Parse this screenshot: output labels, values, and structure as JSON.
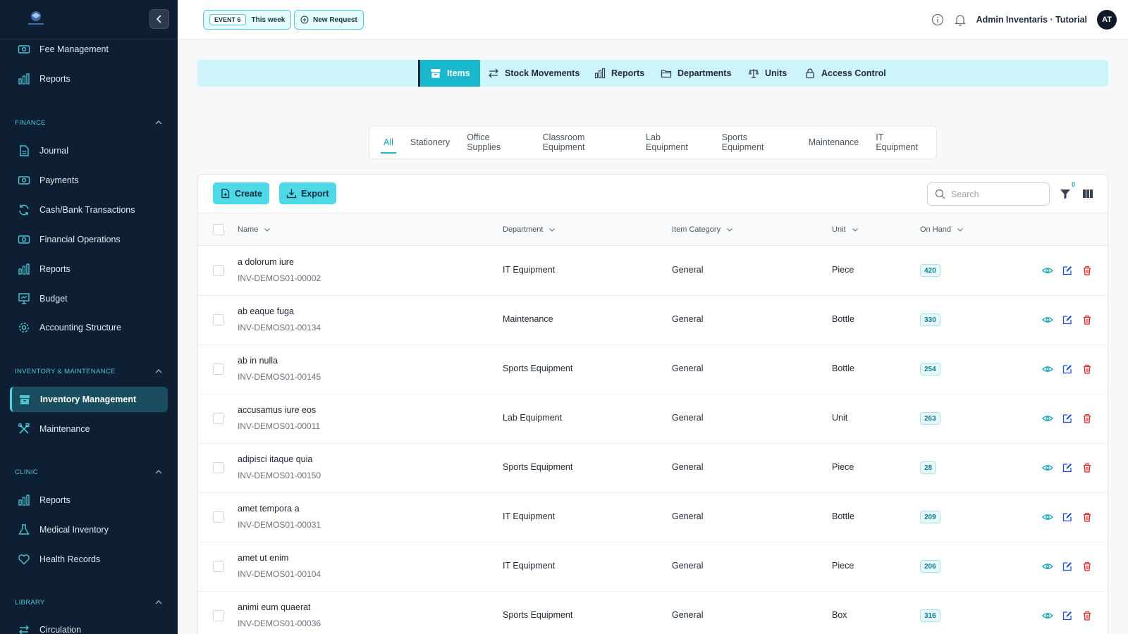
{
  "sidebar": {
    "logo_icon": "school-logo-icon",
    "collapse_icon": "chevron-left-icon",
    "top_items": [
      {
        "label": "Fee Management",
        "icon": "cash-icon"
      },
      {
        "label": "Reports",
        "icon": "bar-chart-icon"
      }
    ],
    "sections": [
      {
        "title": "FINANCE",
        "items": [
          {
            "label": "Journal",
            "icon": "document-icon"
          },
          {
            "label": "Payments",
            "icon": "cash-icon"
          },
          {
            "label": "Cash/Bank Transactions",
            "icon": "refresh-icon"
          },
          {
            "label": "Financial Operations",
            "icon": "cash-icon"
          },
          {
            "label": "Reports",
            "icon": "bar-chart-icon"
          },
          {
            "label": "Budget",
            "icon": "presentation-icon"
          },
          {
            "label": "Accounting Structure",
            "icon": "gear-icon"
          }
        ]
      },
      {
        "title": "INVENTORY & MAINTENANCE",
        "items": [
          {
            "label": "Inventory Management",
            "icon": "archive-icon",
            "active": true
          },
          {
            "label": "Maintenance",
            "icon": "tools-icon"
          }
        ]
      },
      {
        "title": "CLINIC",
        "items": [
          {
            "label": "Reports",
            "icon": "bar-chart-icon"
          },
          {
            "label": "Medical Inventory",
            "icon": "flask-icon"
          },
          {
            "label": "Health Records",
            "icon": "heart-icon"
          }
        ]
      },
      {
        "title": "LIBRARY",
        "items": [
          {
            "label": "Circulation",
            "icon": "swap-icon"
          }
        ]
      }
    ]
  },
  "header": {
    "event_tag": "EVENT 6",
    "event_period": "This week",
    "new_request_label": "New Request",
    "user_name": "Admin Inventaris · Tutorial",
    "avatar_initials": "AT"
  },
  "top_tabs": [
    {
      "label": "Items",
      "icon": "archive-icon",
      "active": true
    },
    {
      "label": "Stock Movements",
      "icon": "swap-icon"
    },
    {
      "label": "Reports",
      "icon": "bar-chart-icon"
    },
    {
      "label": "Departments",
      "icon": "folder-icon"
    },
    {
      "label": "Units",
      "icon": "scale-icon"
    },
    {
      "label": "Access Control",
      "icon": "lock-icon"
    }
  ],
  "category_tabs": [
    "All",
    "Stationery",
    "Office Supplies",
    "Classroom Equipment",
    "Lab Equipment",
    "Sports Equipment",
    "Maintenance",
    "IT Equipment"
  ],
  "toolbar": {
    "create_label": "Create",
    "export_label": "Export",
    "search_placeholder": "Search",
    "filter_count": "0"
  },
  "table": {
    "columns": [
      "Name",
      "Department",
      "Item Category",
      "Unit",
      "On Hand"
    ],
    "rows": [
      {
        "name": "a dolorum iure",
        "code": "INV-DEMOS01-00002",
        "department": "IT Equipment",
        "category": "General",
        "unit": "Piece",
        "on_hand": "420"
      },
      {
        "name": "ab eaque fuga",
        "code": "INV-DEMOS01-00134",
        "department": "Maintenance",
        "category": "General",
        "unit": "Bottle",
        "on_hand": "330"
      },
      {
        "name": "ab in nulla",
        "code": "INV-DEMOS01-00145",
        "department": "Sports Equipment",
        "category": "General",
        "unit": "Bottle",
        "on_hand": "254"
      },
      {
        "name": "accusamus iure eos",
        "code": "INV-DEMOS01-00011",
        "department": "Lab Equipment",
        "category": "General",
        "unit": "Unit",
        "on_hand": "263"
      },
      {
        "name": "adipisci itaque quia",
        "code": "INV-DEMOS01-00150",
        "department": "Sports Equipment",
        "category": "General",
        "unit": "Piece",
        "on_hand": "28"
      },
      {
        "name": "amet tempora a",
        "code": "INV-DEMOS01-00031",
        "department": "IT Equipment",
        "category": "General",
        "unit": "Bottle",
        "on_hand": "209"
      },
      {
        "name": "amet ut enim",
        "code": "INV-DEMOS01-00104",
        "department": "IT Equipment",
        "category": "General",
        "unit": "Piece",
        "on_hand": "206"
      },
      {
        "name": "animi eum quaerat",
        "code": "INV-DEMOS01-00036",
        "department": "Sports Equipment",
        "category": "General",
        "unit": "Box",
        "on_hand": "316"
      }
    ]
  },
  "colors": {
    "sidebar_bg": "#0f1f33",
    "accent": "#19b8cc",
    "accent_light": "#cdf4f9",
    "danger": "#dc2626"
  }
}
